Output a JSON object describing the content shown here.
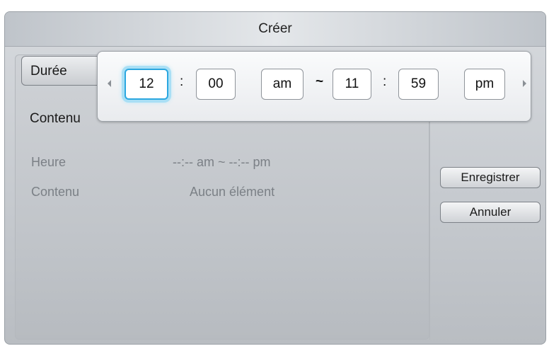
{
  "dialog": {
    "title": "Créer"
  },
  "menu": {
    "duree": "Durée",
    "contenu": "Contenu"
  },
  "info": {
    "heure_label": "Heure",
    "heure_value": "--:-- am ~ --:-- pm",
    "contenu_label": "Contenu",
    "contenu_value": "Aucun élément"
  },
  "buttons": {
    "save": "Enregistrer",
    "cancel": "Annuler"
  },
  "time_picker": {
    "start_hour": "12",
    "start_minute": "00",
    "start_period": "am",
    "range_separator": "~",
    "end_hour": "11",
    "end_minute": "59",
    "end_period": "pm",
    "colon": ":",
    "focus_color": "#2ba7e0"
  }
}
